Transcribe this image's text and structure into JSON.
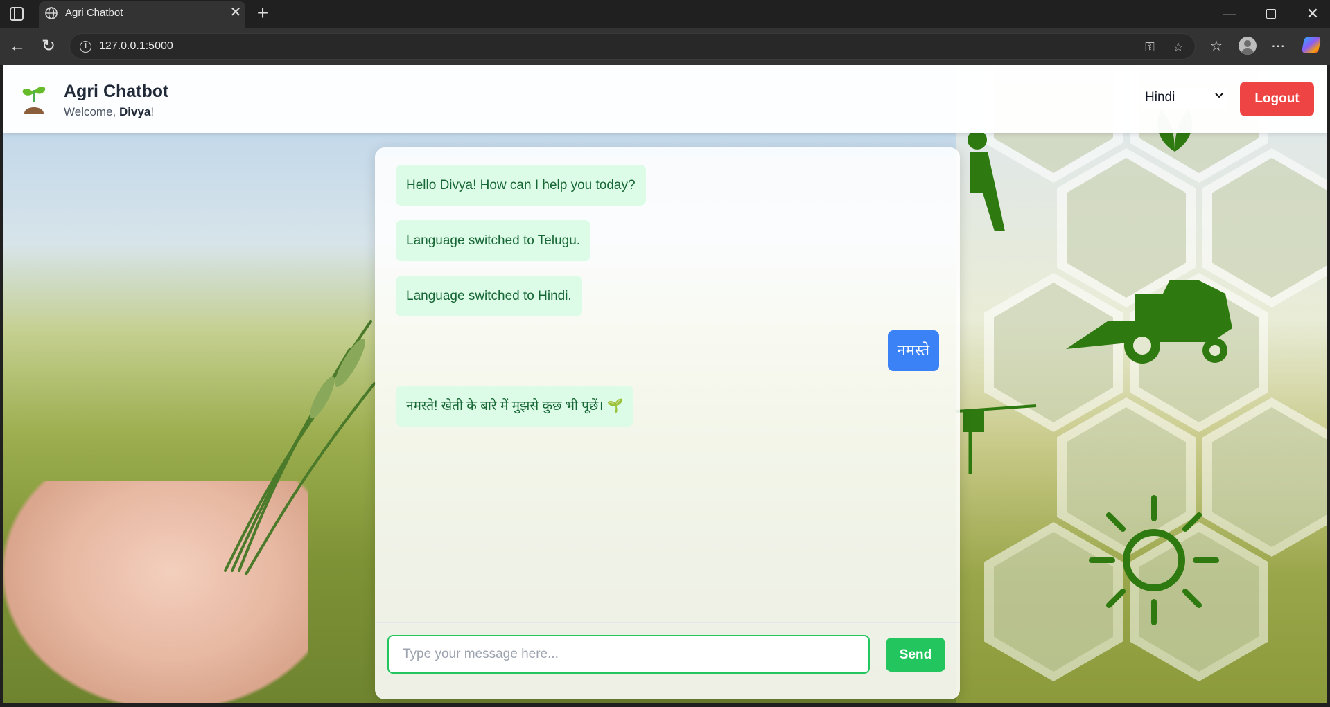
{
  "browser": {
    "tab_title": "Agri Chatbot",
    "url": "127.0.0.1:5000",
    "icons": [
      "tab-strip-icon",
      "globe-icon",
      "close-icon",
      "new-tab-icon",
      "minimize-icon",
      "maximize-icon",
      "window-close-icon",
      "back-icon",
      "reload-icon",
      "info-icon",
      "key-icon",
      "star-icon",
      "favorites-icon",
      "profile-icon",
      "more-icon",
      "copilot-icon"
    ]
  },
  "header": {
    "title": "Agri Chatbot",
    "welcome_prefix": "Welcome, ",
    "user_name": "Divya",
    "welcome_suffix": "!",
    "logo_icon": "seedling-icon",
    "language": "Hindi",
    "logout_label": "Logout"
  },
  "chat": {
    "messages": [
      {
        "sender": "bot",
        "text": "Hello Divya! How can I help you today?"
      },
      {
        "sender": "bot",
        "text": "Language switched to Telugu."
      },
      {
        "sender": "bot",
        "text": "Language switched to Hindi."
      },
      {
        "sender": "user",
        "text": "नमस्ते"
      },
      {
        "sender": "bot",
        "text": "नमस्ते! खेती के बारे में मुझसे कुछ भी पूछें। 🌱"
      }
    ],
    "input_placeholder": "Type your message here...",
    "input_value": "",
    "send_label": "Send"
  },
  "colors": {
    "bot_bubble": "#dcfce7",
    "bot_text": "#166534",
    "user_bubble": "#3b82f6",
    "send_button": "#22c55e",
    "logout_button": "#ef4444"
  }
}
